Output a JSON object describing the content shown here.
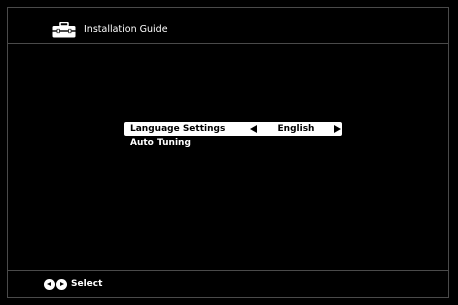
{
  "header": {
    "icon": "toolbox-icon",
    "title": "Installation Guide"
  },
  "menu": {
    "items": [
      {
        "label": "Language Settings",
        "value": "English",
        "selected": true
      },
      {
        "label": "Auto Tuning",
        "selected": false
      }
    ]
  },
  "footer": {
    "icons": [
      "left-arrow-button-icon",
      "right-arrow-button-icon"
    ],
    "hint": "Select"
  },
  "colors": {
    "background": "#000000",
    "divider": "#4a4a4a",
    "text": "#ffffff",
    "highlight": "#ffffff",
    "highlight_text": "#000000"
  }
}
